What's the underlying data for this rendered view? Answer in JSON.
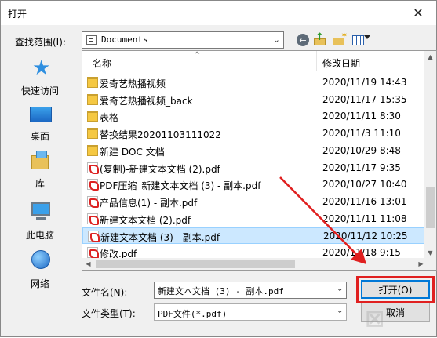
{
  "window": {
    "title": "打开",
    "close_glyph": "✕"
  },
  "lookin": {
    "label": "查找范围(I):",
    "value": "Documents"
  },
  "toolbar": {
    "back_icon": "back-arrow-icon",
    "up_icon": "up-folder-icon",
    "new_folder_icon": "new-folder-icon",
    "view_icon": "view-menu-icon"
  },
  "places": [
    {
      "label": "快速访问",
      "icon": "quick-access-star-icon"
    },
    {
      "label": "桌面",
      "icon": "desktop-icon"
    },
    {
      "label": "库",
      "icon": "libraries-icon"
    },
    {
      "label": "此电脑",
      "icon": "this-pc-icon"
    },
    {
      "label": "网络",
      "icon": "network-icon"
    }
  ],
  "columns": {
    "name": "名称",
    "date": "修改日期"
  },
  "files": [
    {
      "name": "爱奇艺热播视频",
      "date": "2020/11/19 14:43",
      "type": "folder"
    },
    {
      "name": "爱奇艺热播视频_back",
      "date": "2020/11/17 15:35",
      "type": "folder"
    },
    {
      "name": "表格",
      "date": "2020/11/11 8:30",
      "type": "folder"
    },
    {
      "name": "替换结果20201103111022",
      "date": "2020/11/3 11:10",
      "type": "folder"
    },
    {
      "name": "新建 DOC 文档",
      "date": "2020/10/29 8:48",
      "type": "folder"
    },
    {
      "name": "(复制)-新建文本文档 (2).pdf",
      "date": "2020/11/17 9:35",
      "type": "pdf"
    },
    {
      "name": "PDF压缩_新建文本文档 (3) - 副本.pdf",
      "date": "2020/10/27 10:40",
      "type": "pdf"
    },
    {
      "name": "产品信息(1) - 副本.pdf",
      "date": "2020/11/16 13:01",
      "type": "pdf"
    },
    {
      "name": "新建文本文档 (2).pdf",
      "date": "2020/11/11 11:08",
      "type": "pdf"
    },
    {
      "name": "新建文本文档 (3) - 副本.pdf",
      "date": "2020/11/12 10:25",
      "type": "pdf",
      "selected": true
    },
    {
      "name": "修改.pdf",
      "date": "2020/11/18 9:15",
      "type": "pdf"
    }
  ],
  "filename": {
    "label": "文件名(N):",
    "value": "新建文本文档 (3) - 副本.pdf"
  },
  "filetype": {
    "label": "文件类型(T):",
    "value": "PDF文件(*.pdf)"
  },
  "buttons": {
    "open": "打开(O)",
    "cancel": "取消"
  },
  "annotation_color": "#e02020"
}
